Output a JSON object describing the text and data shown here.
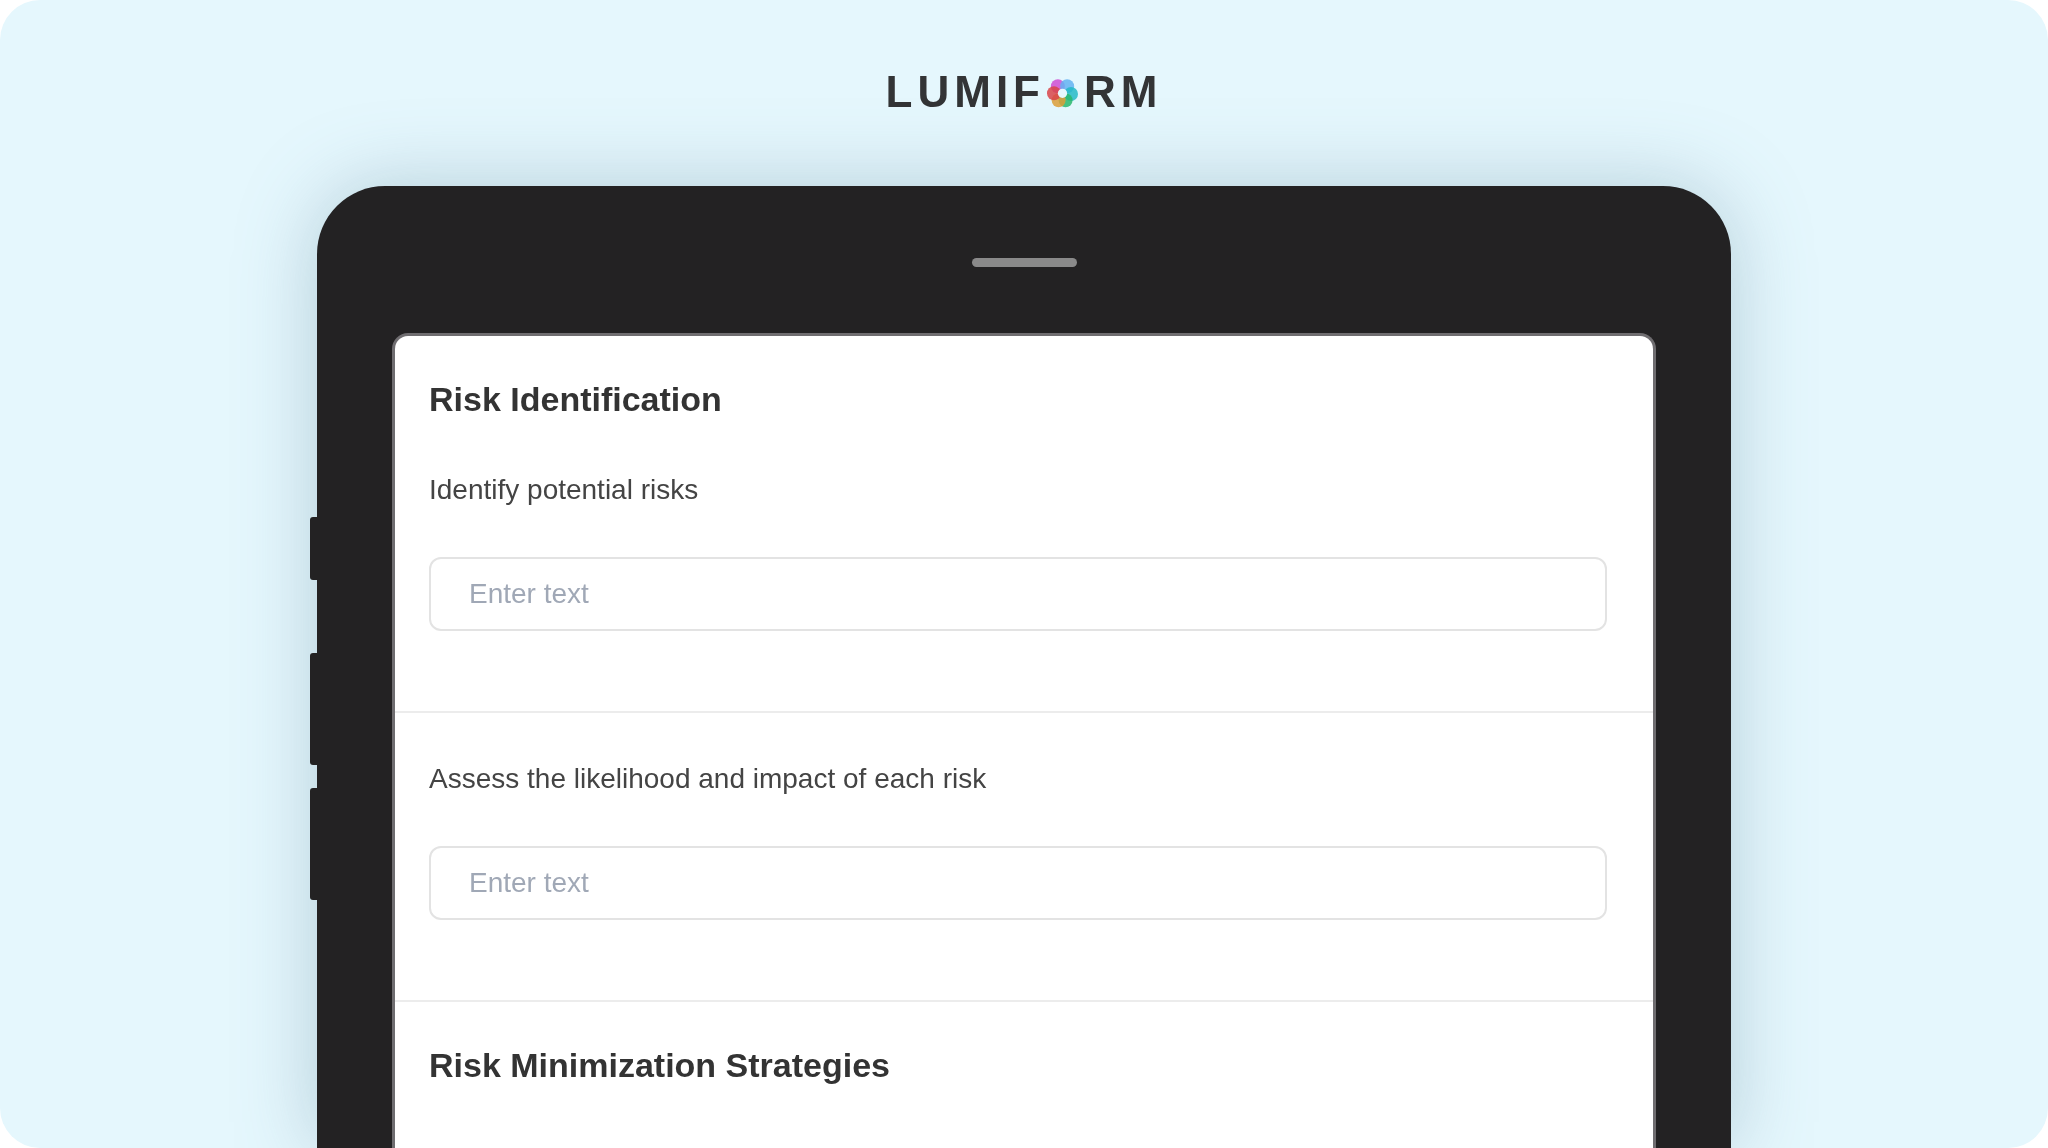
{
  "logo": {
    "before": "LUMIF",
    "after": "RM"
  },
  "sections": [
    {
      "title": "Risk Identification",
      "questions": [
        {
          "label": "Identify potential risks",
          "placeholder": "Enter text"
        },
        {
          "label": "Assess the likelihood and impact of each risk",
          "placeholder": "Enter text"
        }
      ]
    },
    {
      "title": "Risk Minimization Strategies"
    }
  ]
}
